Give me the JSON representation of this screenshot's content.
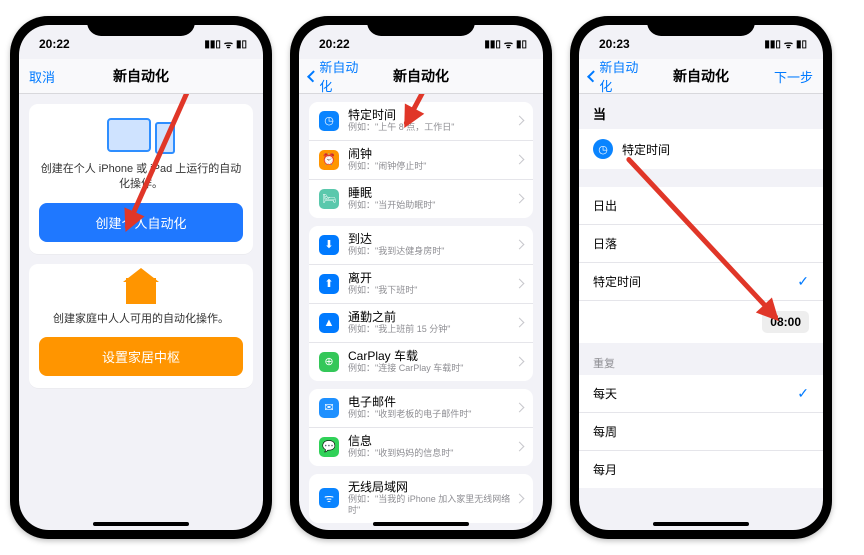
{
  "statusbar": {
    "time1": "20:22",
    "time2": "20:22",
    "time3": "20:23"
  },
  "phone1": {
    "nav_left": "取消",
    "nav_title": "新自动化",
    "card1_text": "创建在个人 iPhone 或 iPad 上运行的自动化操作。",
    "card1_btn": "创建个人自动化",
    "card2_text": "创建家庭中人人可用的自动化操作。",
    "card2_btn": "设置家居中枢"
  },
  "phone2": {
    "nav_back": "新自动化",
    "nav_title": "新自动化",
    "rows": [
      {
        "title": "特定时间",
        "sub": "例如：\"上午 8 点，工作日\""
      },
      {
        "title": "闹钟",
        "sub": "例如：\"闹钟停止时\""
      },
      {
        "title": "睡眠",
        "sub": "例如：\"当开始助眠时\""
      },
      {
        "title": "到达",
        "sub": "例如：\"我到达健身房时\""
      },
      {
        "title": "离开",
        "sub": "例如：\"我下班时\""
      },
      {
        "title": "通勤之前",
        "sub": "例如：\"我上班前 15 分钟\""
      },
      {
        "title": "CarPlay 车载",
        "sub": "例如：\"连接 CarPlay 车载时\""
      },
      {
        "title": "电子邮件",
        "sub": "例如：\"收到老板的电子邮件时\""
      },
      {
        "title": "信息",
        "sub": "例如：\"收到妈妈的信息时\""
      },
      {
        "title": "无线局域网",
        "sub": "例如：\"当我的 iPhone 加入家里无线网络时\""
      }
    ]
  },
  "phone3": {
    "nav_back": "新自动化",
    "nav_title": "新自动化",
    "nav_next": "下一步",
    "when_header": "当",
    "selected_trigger": "特定时间",
    "time_options": {
      "sunrise": "日出",
      "sunset": "日落",
      "specific": "特定时间"
    },
    "time_value": "08:00",
    "repeat_header": "重复",
    "repeat": {
      "daily": "每天",
      "weekly": "每周",
      "monthly": "每月"
    }
  }
}
